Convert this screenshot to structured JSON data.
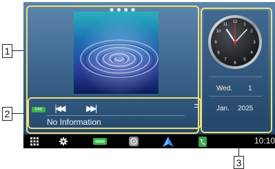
{
  "callouts": {
    "c1": "1",
    "c2": "2",
    "c3": "3"
  },
  "media": {
    "source_icon": "source-logo-icon",
    "source_label": "DAB",
    "prev_symbol": "|◀◀",
    "next_symbol": "▶▶|",
    "status": "No Information"
  },
  "clock": {
    "weekday": "Wed.",
    "day": "1",
    "month": "Jan.",
    "year": "2025"
  },
  "taskbar": {
    "time": "10:10",
    "icons": [
      "apps-grid-icon",
      "settings-gear-icon",
      "dab-source-icon",
      "media-play-icon",
      "navigation-arrow-icon",
      "phone-icon"
    ]
  },
  "colors": {
    "highlight": "#f0e07a",
    "accent_green": "#3cb44b",
    "background": "#3f6a92"
  }
}
